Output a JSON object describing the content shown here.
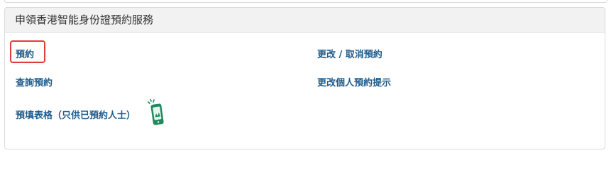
{
  "panel": {
    "title": "申領香港智能身份證預約服務"
  },
  "links": {
    "book": "預約",
    "change_cancel": "更改 / 取消預約",
    "enquire": "查詢預約",
    "change_reminder": "更改個人預約提示",
    "prefill_form": "預填表格（只供已預約人士）"
  },
  "colors": {
    "link": "#1d5b8c",
    "highlight_border": "#e23b3b",
    "header_bg": "#f2f2f2",
    "phone_icon": "#1f8a5f"
  },
  "icons": {
    "mobile": "mobile-phone-icon"
  }
}
